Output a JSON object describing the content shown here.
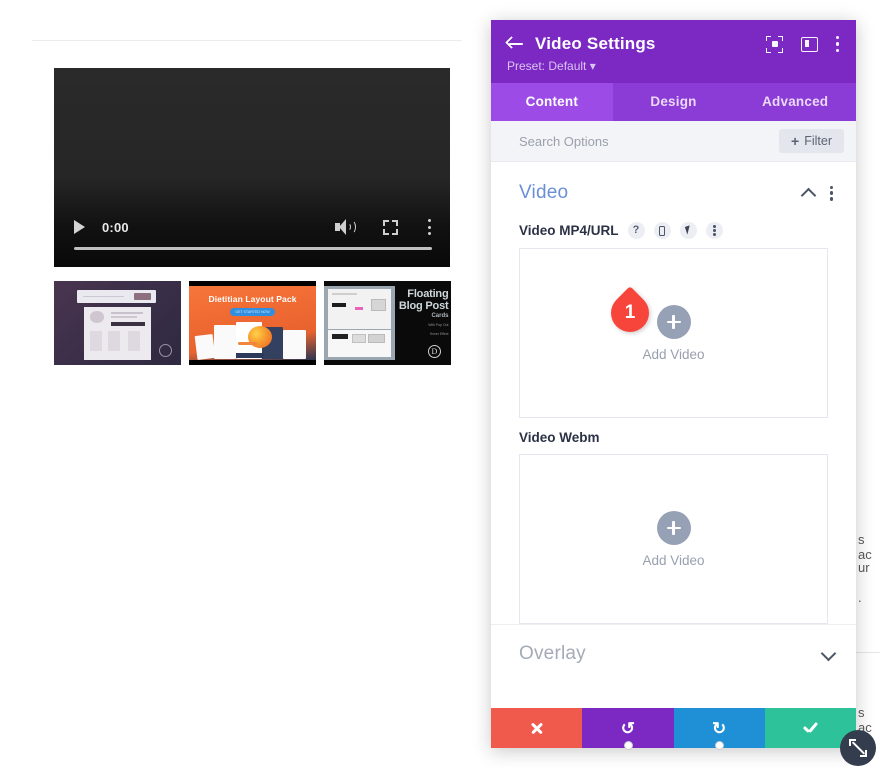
{
  "player": {
    "time": "0:00",
    "play_icon": "play-icon",
    "volume_icon": "volume-icon",
    "fullscreen_icon": "fullscreen-icon",
    "more_icon": "more-options-icon"
  },
  "thumbnails": [
    {
      "name": "thumbnail-1",
      "title": ""
    },
    {
      "name": "thumbnail-2",
      "title": "Dietitian Layout Pack",
      "cta": "GET STARTED NOW"
    },
    {
      "name": "thumbnail-3",
      "title_line1": "Floating",
      "title_line2": "Blog Post",
      "subtitle": "Cards",
      "caption_line1": "With Pop Out",
      "caption_line2": "Hover Effect",
      "logo": "D"
    }
  ],
  "background_fragments": {
    "frag1": "s ac",
    "frag2": "ur",
    "frag3": ".",
    "frag4": "s ac"
  },
  "modal": {
    "title": "Video Settings",
    "preset": "Preset: Default",
    "preset_caret": "▾",
    "back_icon": "back-arrow-icon",
    "header_icons": [
      {
        "name": "focus-mode-icon"
      },
      {
        "name": "panel-layout-icon"
      },
      {
        "name": "more-options-icon"
      }
    ],
    "tabs": [
      {
        "label": "Content",
        "active": true
      },
      {
        "label": "Design",
        "active": false
      },
      {
        "label": "Advanced",
        "active": false
      }
    ],
    "search": {
      "placeholder": "Search Options",
      "value": ""
    },
    "filter_button": {
      "label": "Filter",
      "plus": "+"
    },
    "sections": [
      {
        "title": "Video",
        "collapse_icon": "chevron-up-icon",
        "menu_icon": "more-options-icon",
        "expanded": true,
        "fields": [
          {
            "label": "Video MP4/URL",
            "icons": [
              {
                "name": "help-icon",
                "glyph": "?"
              },
              {
                "name": "responsive-mobile-icon"
              },
              {
                "name": "hover-cursor-icon"
              },
              {
                "name": "more-options-icon"
              }
            ],
            "upload": {
              "label": "Add Video",
              "plus_icon": "plus-icon"
            },
            "annotation": {
              "number": "1",
              "color": "#f8453b"
            }
          },
          {
            "label": "Video Webm",
            "icons": [],
            "upload": {
              "label": "Add Video",
              "plus_icon": "plus-icon"
            }
          }
        ]
      },
      {
        "title": "Overlay",
        "collapse_icon": "chevron-down-icon",
        "expanded": false
      }
    ],
    "footer_buttons": [
      {
        "name": "cancel-button",
        "icon": "close-x-icon",
        "color": "#ef5a4c"
      },
      {
        "name": "undo-button",
        "icon": "undo-icon",
        "color": "#7c29c4",
        "glyph": "↺"
      },
      {
        "name": "redo-button",
        "icon": "redo-icon",
        "color": "#1f8fd6",
        "glyph": "↻"
      },
      {
        "name": "save-button",
        "icon": "checkmark-icon",
        "color": "#2ec29a"
      }
    ]
  },
  "resize_handle": {
    "name": "resize-handle-icon"
  },
  "colors": {
    "brand_purple": "#7c29c4",
    "tab_bar": "#8b3bd6",
    "tab_active": "#9d4be6",
    "section_title": "#6a8fd8",
    "annotation_red": "#f8453b"
  }
}
